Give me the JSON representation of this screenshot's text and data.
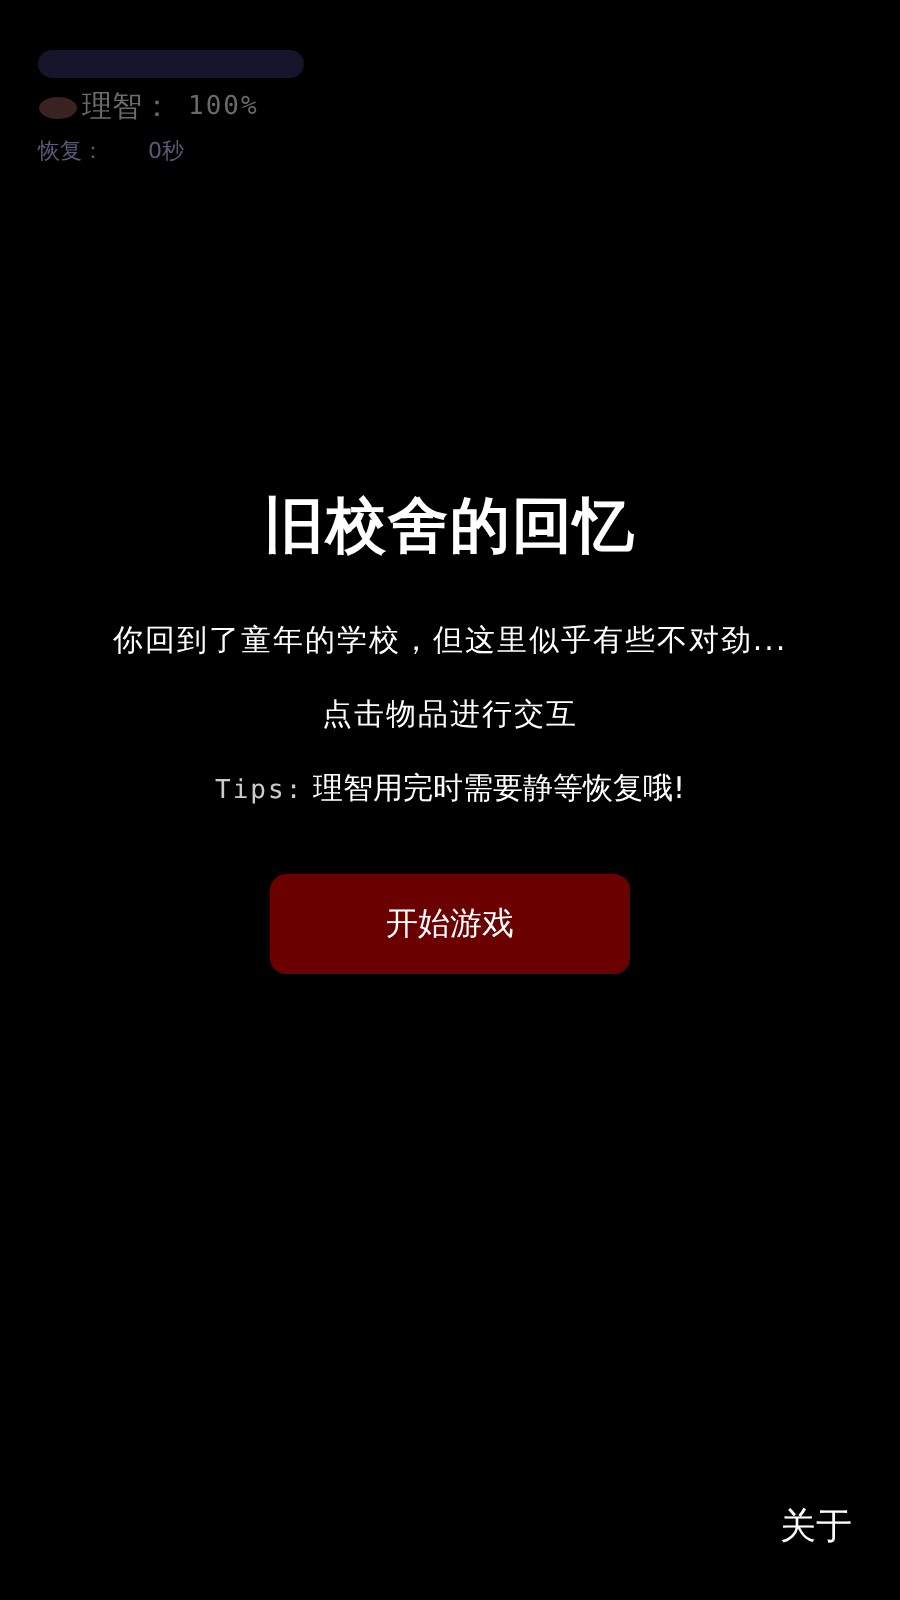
{
  "hud": {
    "sanity_bar": {
      "level": 1
    },
    "sanity_label": "理智：",
    "sanity_value": "100%",
    "recovery_label": "恢复：",
    "recovery_value": "0秒"
  },
  "intro": {
    "title": "旧校舍的回忆",
    "description": "你回到了童年的学校，但这里似乎有些不对劲...",
    "hint": "点击物品进行交互",
    "tips_label": "Tips:",
    "tips_text": "理智用完时需要静等恢复哦!"
  },
  "start_button": "开始游戏",
  "about_link": "关于"
}
